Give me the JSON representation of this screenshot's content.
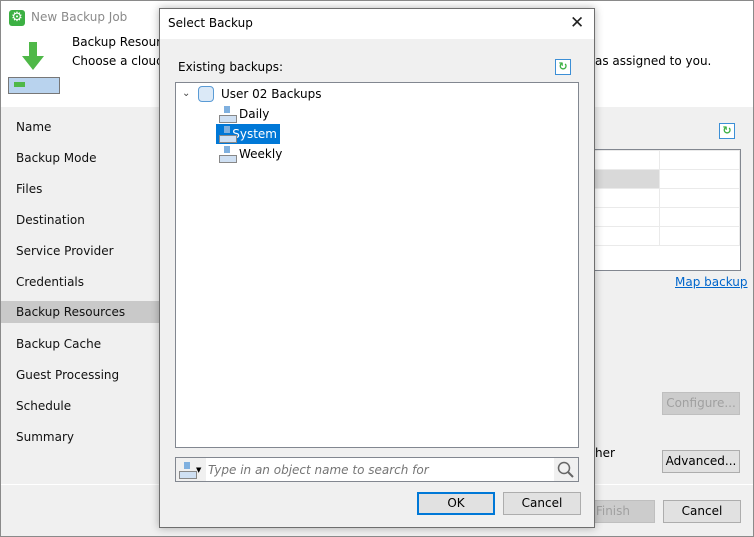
{
  "window": {
    "title": "New Backup Job",
    "step_title": "Backup Resource",
    "step_desc": "Choose a cloud b",
    "step_desc_tail": "as assigned to you."
  },
  "nav": {
    "items": [
      "Name",
      "Backup Mode",
      "Files",
      "Destination",
      "Service Provider",
      "Credentials",
      "Backup Resources",
      "Backup Cache",
      "Guest Processing",
      "Schedule",
      "Summary"
    ],
    "selected_index": 6
  },
  "main": {
    "map_backup_link": "Map backup",
    "configure_button": "Configure...",
    "partial_text": "her",
    "advanced_button": "Advanced...",
    "finish_button": "Finish",
    "cancel_button": "Cancel"
  },
  "dialog": {
    "title": "Select Backup",
    "close_icon": "close-icon",
    "existing_label": "Existing backups:",
    "tree": {
      "root": "User 02 Backups",
      "children": [
        "Daily",
        "System",
        "Weekly"
      ],
      "selected": "System"
    },
    "search": {
      "placeholder": "Type in an object name to search for"
    },
    "ok_button": "OK",
    "cancel_button": "Cancel"
  },
  "colors": {
    "accent": "#0078d7",
    "link": "#0066cc",
    "veeam_green": "#3cb043"
  }
}
